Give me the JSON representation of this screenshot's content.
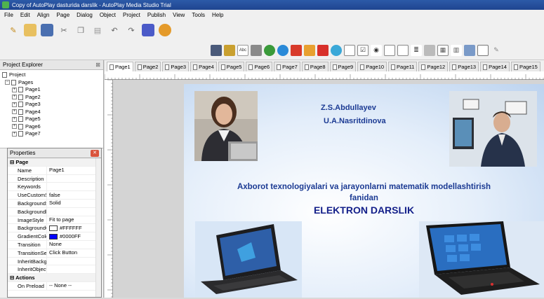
{
  "window": {
    "title": "Copy of AutoPlay dasturida darslik - AutoPlay Media Studio Trial"
  },
  "menu": [
    "File",
    "Edit",
    "Align",
    "Page",
    "Dialog",
    "Object",
    "Project",
    "Publish",
    "View",
    "Tools",
    "Help"
  ],
  "project_explorer": {
    "title": "Project Explorer",
    "root": "Project",
    "pages_label": "Pages",
    "pages": [
      "Page1",
      "Page2",
      "Page3",
      "Page4",
      "Page5",
      "Page6",
      "Page7"
    ]
  },
  "properties": {
    "title": "Properties",
    "category_page": "Page",
    "rows": [
      {
        "key": "Name",
        "value": "Page1"
      },
      {
        "key": "Description",
        "value": ""
      },
      {
        "key": "Keywords",
        "value": ""
      },
      {
        "key": "UseCustomSe",
        "value": "false"
      },
      {
        "key": "BackgroundSt",
        "value": "Solid"
      },
      {
        "key": "Backgroundln",
        "value": ""
      },
      {
        "key": "ImageStyle",
        "value": "Fit to page"
      },
      {
        "key": "BackgroundC",
        "value": "#FFFFFF"
      },
      {
        "key": "GradientColor",
        "value": "#0000FF"
      },
      {
        "key": "Transition",
        "value": "None"
      },
      {
        "key": "TransitionSett",
        "value": "Click Button"
      },
      {
        "key": "InheritBackgrc",
        "value": ""
      },
      {
        "key": "InheritObjects",
        "value": ""
      }
    ],
    "category_actions": "Actions",
    "preload_key": "On Preload",
    "preload_value": "-- None --",
    "colors": {
      "background": "#FFFFFF",
      "gradient": "#0000FF"
    }
  },
  "tabs": [
    "Page1",
    "Page2",
    "Page3",
    "Page4",
    "Page5",
    "Page6",
    "Page7",
    "Page8",
    "Page9",
    "Page10",
    "Page11",
    "Page12",
    "Page13",
    "Page14",
    "Page15"
  ],
  "page": {
    "author1": "Z.S.Abdullayev",
    "author2": "U.A.Nasritdinova",
    "subject_line1": "Axborot texnologiyalari va jarayonlarni matematik modellashtirish",
    "subject_line2": "fanidan",
    "doc_type": "ELEKTRON DARSLIK"
  }
}
